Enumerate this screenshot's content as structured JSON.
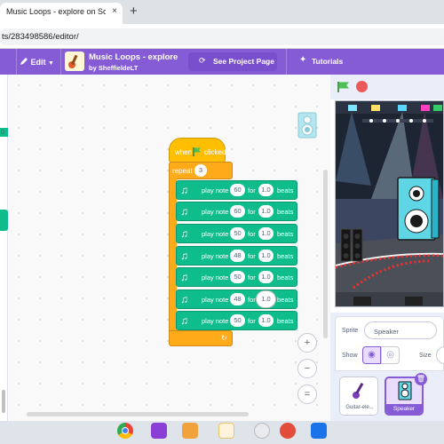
{
  "browser": {
    "tab_title": "Music Loops - explore on Scratch",
    "tab_close": "×",
    "new_tab": "+",
    "url": "ts/283498586/editor/"
  },
  "menu": {
    "edit_label": "Edit",
    "project_title": "Music Loops - explore",
    "project_author": "by SheffieldeLT",
    "see_project_label": "See Project Page",
    "tutorials_label": "Tutorials"
  },
  "left_strip": {
    "value": "0"
  },
  "script": {
    "hat_when": "when",
    "hat_clicked": "clicked",
    "repeat_label": "repeat",
    "repeat_count": "3",
    "notes": [
      {
        "play": "play note",
        "note": "60",
        "for": "for",
        "beats_value": "1.0",
        "beats": "beats"
      },
      {
        "play": "play note",
        "note": "60",
        "for": "for",
        "beats_value": "1.0",
        "beats": "beats"
      },
      {
        "play": "play note",
        "note": "50",
        "for": "for",
        "beats_value": "1.0",
        "beats": "beats"
      },
      {
        "play": "play note",
        "note": "48",
        "for": "for",
        "beats_value": "1.0",
        "beats": "beats"
      },
      {
        "play": "play note",
        "note": "50",
        "for": "for",
        "beats_value": "1.0",
        "beats": "beats"
      },
      {
        "play": "play note",
        "note": "48",
        "for": "for",
        "beats_value": "1.0",
        "beats": "beats"
      },
      {
        "play": "play note",
        "note": "50",
        "for": "for",
        "beats_value": "1.0",
        "beats": "beats"
      }
    ]
  },
  "zoom": {
    "zoom_in": "+",
    "zoom_out": "−",
    "reset": "="
  },
  "sprite_info": {
    "sprite_label": "Sprite",
    "sprite_name": "Speaker",
    "show_label": "Show",
    "size_label": "Size"
  },
  "sprites": [
    {
      "name": "Guitar-ele..."
    },
    {
      "name": "Speaker"
    }
  ],
  "colors": {
    "menu": "#855cd6",
    "music_block": "#0fbd8c",
    "control_block": "#ffab19",
    "event_block": "#ffbf00",
    "selected_sprite": "#855cd6"
  }
}
